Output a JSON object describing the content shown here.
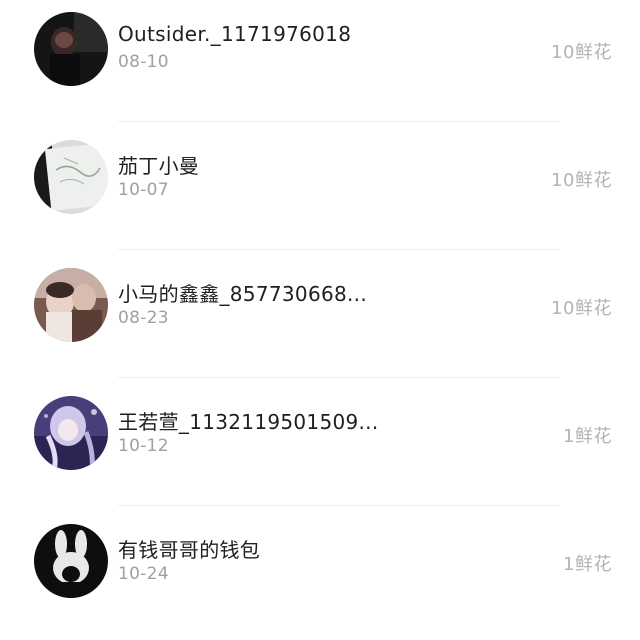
{
  "gifts_list": [
    {
      "name": "Outsider._1171976018",
      "date": "08-10",
      "gift": "10鲜花",
      "avatar_icon": "dark-portrait-avatar"
    },
    {
      "name": "茄丁小曼",
      "date": "10-07",
      "gift": "10鲜花",
      "avatar_icon": "sketch-drawing-avatar"
    },
    {
      "name": "小马的鑫鑫_857730668...",
      "date": "08-23",
      "gift": "10鲜花",
      "avatar_icon": "couple-photo-avatar"
    },
    {
      "name": "王若萱_1132119501509...",
      "date": "10-12",
      "gift": "1鲜花",
      "avatar_icon": "anime-girl-avatar"
    },
    {
      "name": "有钱哥哥的钱包",
      "date": "10-24",
      "gift": "1鲜花",
      "avatar_icon": "white-rabbit-avatar"
    }
  ]
}
